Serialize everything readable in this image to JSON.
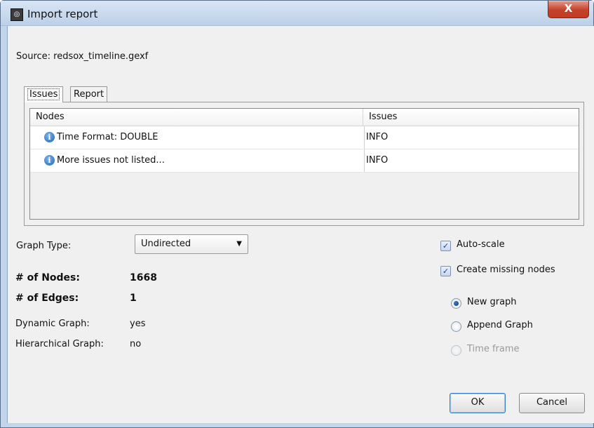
{
  "window": {
    "title": "Import report",
    "close_label": "X"
  },
  "source": {
    "label": "Source:",
    "file": "redsox_timeline.gexf"
  },
  "tabs": [
    {
      "label": "Issues"
    },
    {
      "label": "Report"
    }
  ],
  "table": {
    "columns": [
      "Nodes",
      "Issues"
    ],
    "rows": [
      {
        "node": "Time Format: DOUBLE",
        "issue": "INFO"
      },
      {
        "node": "More issues not listed...",
        "issue": "INFO"
      }
    ]
  },
  "graph_type": {
    "label": "Graph Type:",
    "value": "Undirected"
  },
  "stats": {
    "nodes_label": "# of Nodes:",
    "nodes_value": "1668",
    "edges_label": "# of Edges:",
    "edges_value": "1",
    "dynamic_label": "Dynamic Graph:",
    "dynamic_value": "yes",
    "hier_label": "Hierarchical Graph:",
    "hier_value": "no"
  },
  "options": {
    "auto_scale": {
      "label": "Auto-scale",
      "checked": true
    },
    "create_missing": {
      "label": "Create missing nodes",
      "checked": true
    },
    "radios": [
      {
        "label": "New graph",
        "selected": true,
        "enabled": true
      },
      {
        "label": "Append Graph",
        "selected": false,
        "enabled": true
      },
      {
        "label": "Time frame",
        "selected": false,
        "enabled": false
      }
    ]
  },
  "buttons": {
    "ok": "OK",
    "cancel": "Cancel"
  }
}
